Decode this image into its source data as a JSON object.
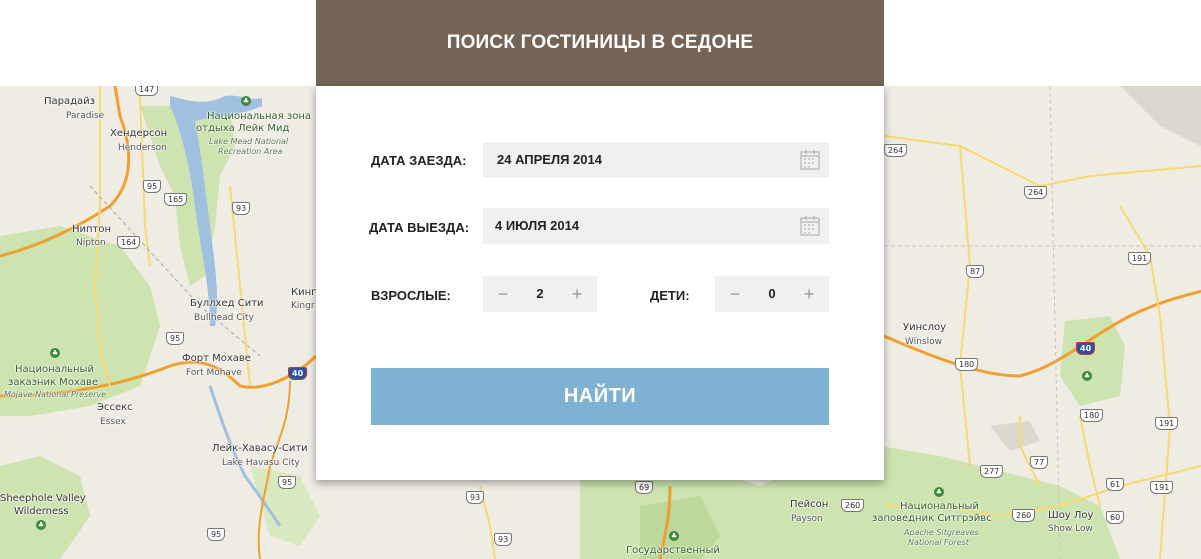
{
  "header": {
    "title": "ПОИСК ГОСТИНИЦЫ В СЕДОНЕ"
  },
  "form": {
    "checkin": {
      "label": "ДАТА ЗАЕЗДА:",
      "value": "24 АПРЕЛЯ 2014"
    },
    "checkout": {
      "label": "ДАТА ВЫЕЗДА:",
      "value": "4 ИЮЛЯ 2014"
    },
    "adults": {
      "label": "ВЗРОСЛЫЕ:",
      "value": "2",
      "minus": "−",
      "plus": "+"
    },
    "children": {
      "label": "ДЕТИ:",
      "value": "0",
      "minus": "−",
      "plus": "+"
    },
    "submit_label": "НАЙТИ",
    "accent_color": "#7fb1d3",
    "header_color": "#756355"
  },
  "map": {
    "labels": {
      "paradise_ru": "Парадайз",
      "paradise_en": "Paradise",
      "henderson_ru": "Хендерсон",
      "henderson_en": "Henderson",
      "lake_mead_ru1": "Национальная зона",
      "lake_mead_ru2": "отдыха Лейк Мид",
      "lake_mead_en1": "Lake Mead National",
      "lake_mead_en2": "Recreation Area",
      "nipton_ru": "Ниптон",
      "nipton_en": "Nipton",
      "bullhead_ru": "Буллхед Сити",
      "bullhead_en": "Bullhead City",
      "kingman_ru": "Кинг",
      "kingman_en": "Kingr",
      "mojave_ru1": "Национальный",
      "mojave_ru2": "заказник Мохаве",
      "mojave_en": "Mojave National Preserve",
      "fort_mohave_ru": "Форт Мохаве",
      "fort_mohave_en": "Fort Mohave",
      "essex_ru": "Эссекс",
      "essex_en": "Essex",
      "havasu_ru": "Лейк-Хавасу-Сити",
      "havasu_en": "Lake Havasu City",
      "sheephole_en1": "Sheephole Valley",
      "sheephole_en2": "Wilderness",
      "winslow_ru": "Уинслоу",
      "winslow_en": "Winslow",
      "payson_ru": "Пейсон",
      "payson_en": "Payson",
      "sitgreaves_ru1": "Национальный",
      "sitgreaves_ru2": "заповедник Ситгрэйвс",
      "sitgreaves_en1": "Apache Sitgreaves",
      "sitgreaves_en2": "National Forest",
      "showlow_ru": "Шоу Лоу",
      "showlow_en": "Show Low",
      "gos_ru": "Государственный"
    },
    "shields": {
      "r147": "147",
      "r165": "165",
      "r95a": "95",
      "r93a": "93",
      "r164": "164",
      "r95b": "95",
      "i40a": "40",
      "r95c": "95",
      "r95d": "95",
      "r264a": "264",
      "r264b": "264",
      "r87": "87",
      "r191a": "191",
      "i40b": "40",
      "r180a": "180",
      "r180b": "180",
      "r191b": "191",
      "r277": "277",
      "r77": "77",
      "r61": "61",
      "r191c": "191",
      "r260a": "260",
      "r260b": "260",
      "r60": "60",
      "r93b": "93",
      "r93c": "93",
      "r69": "69"
    }
  }
}
